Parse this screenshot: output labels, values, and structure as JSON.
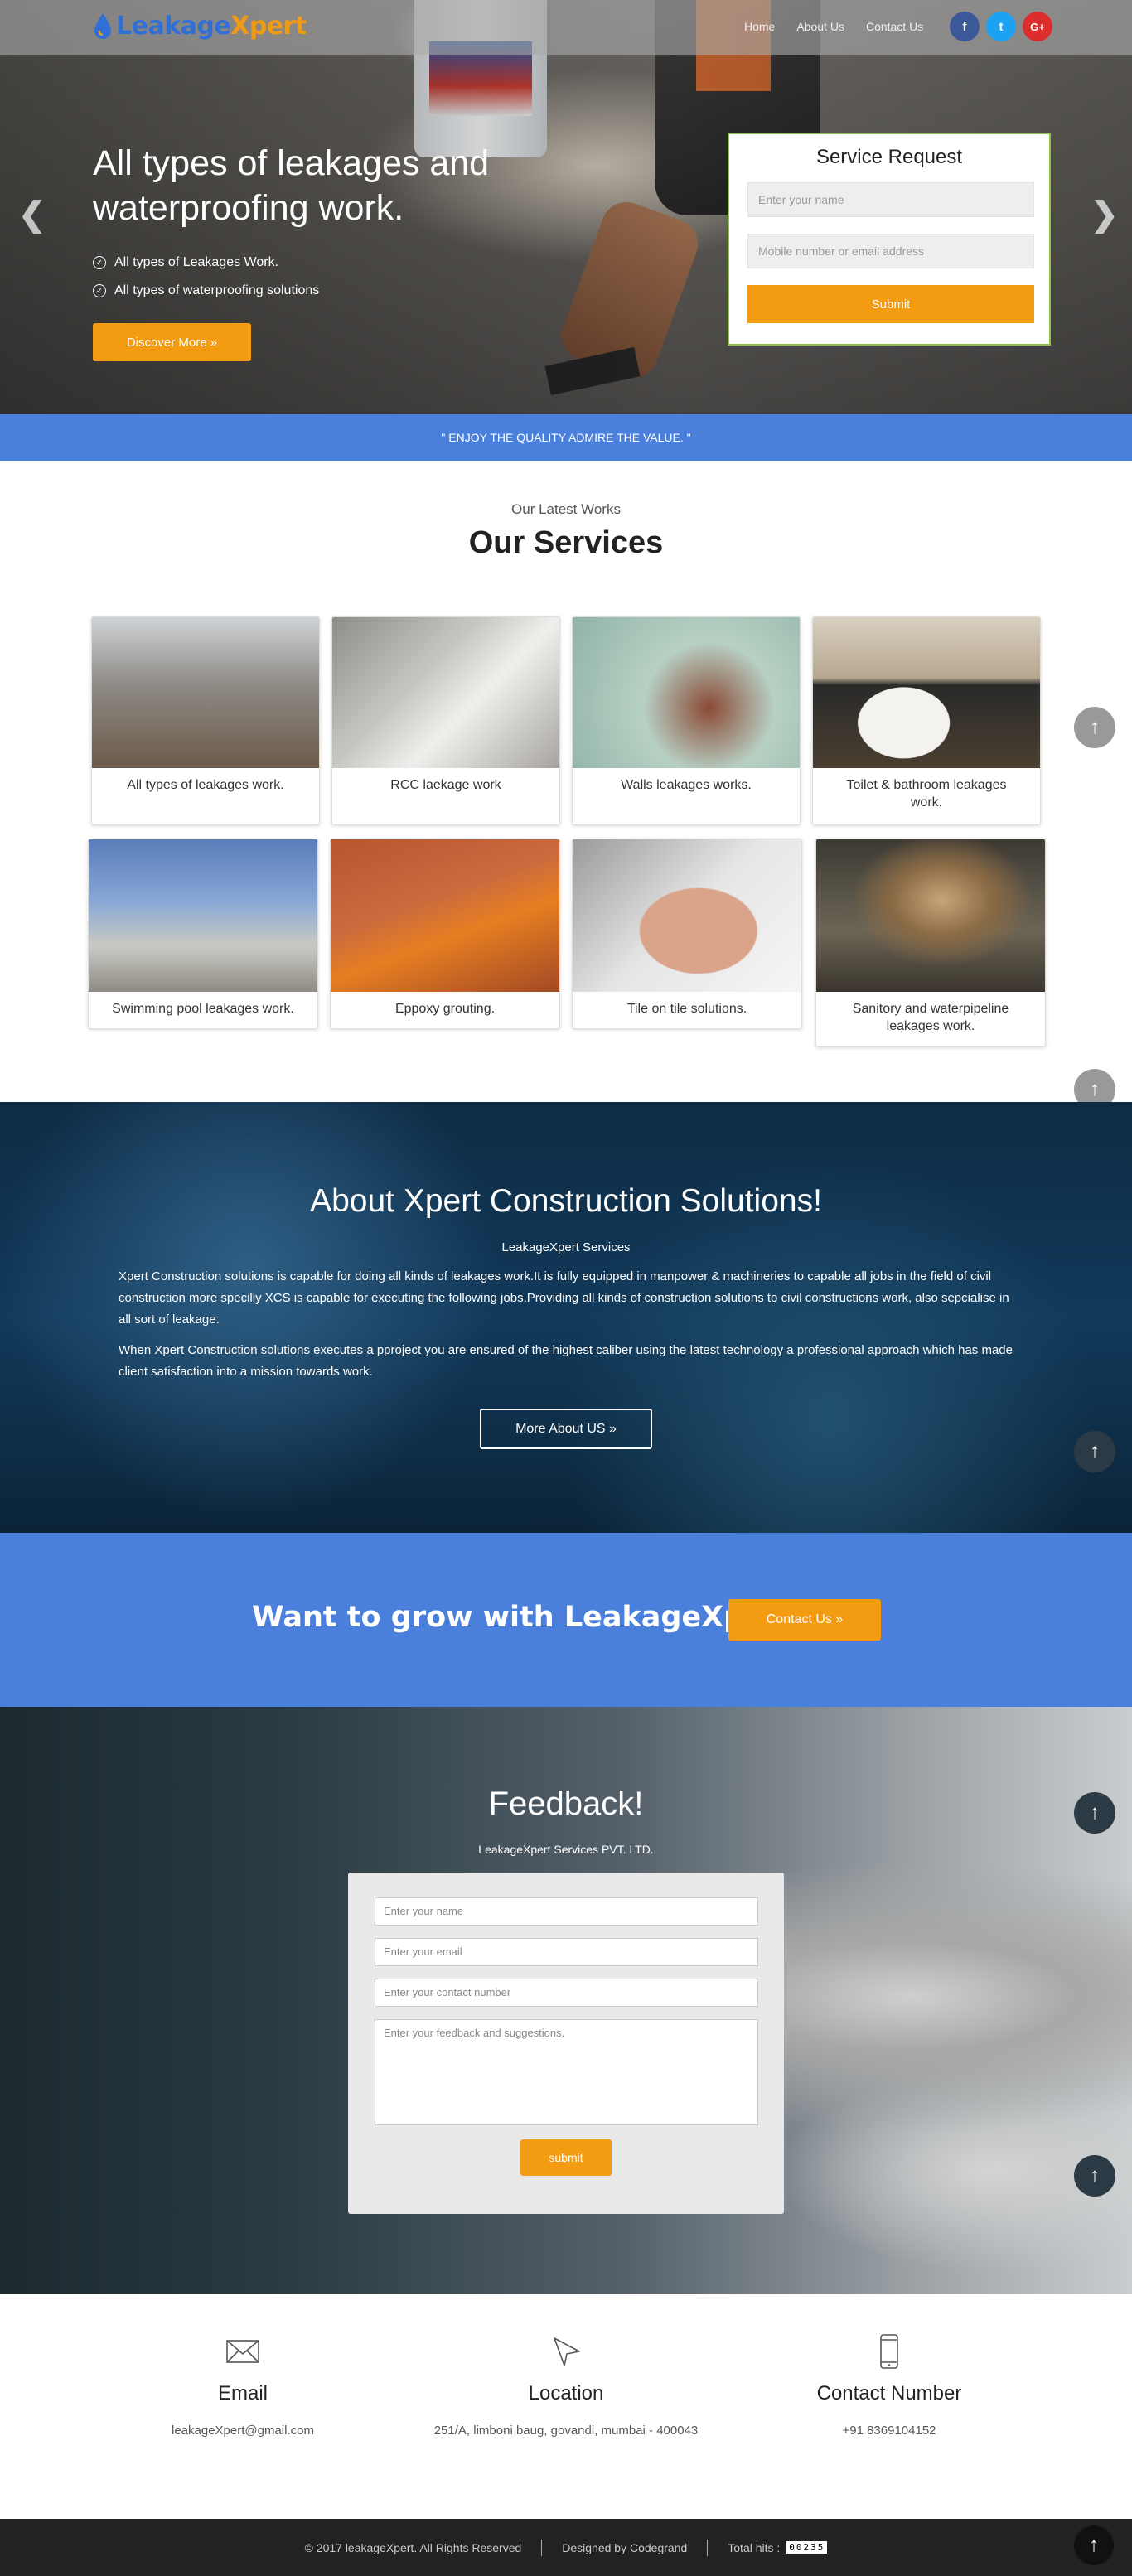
{
  "header": {
    "logo_part1": "Leakage",
    "logo_part2": "Xpert",
    "nav": [
      "Home",
      "About Us",
      "Contact Us"
    ],
    "social": [
      {
        "icon": "facebook-icon",
        "glyph": "f",
        "color": "#3b5998"
      },
      {
        "icon": "twitter-icon",
        "glyph": "t",
        "color": "#1da1f2"
      },
      {
        "icon": "google-plus-icon",
        "glyph": "G+",
        "color": "#dd2c2c"
      }
    ]
  },
  "hero": {
    "title": "All types of leakages and waterproofing work.",
    "bullets": [
      "All types of Leakages Work.",
      "All types of waterproofing solutions"
    ],
    "discover_label": "Discover More »"
  },
  "service_request": {
    "title": "Service Request",
    "name_placeholder": "Enter your name",
    "contact_placeholder": "Mobile number or email address",
    "submit_label": "Submit"
  },
  "tagline": "\" ENJOY THE QUALITY ADMIRE THE VALUE. \"",
  "services": {
    "subtitle": "Our Latest Works",
    "title": "Our Services",
    "items": [
      "All types of leakages work.",
      "RCC laekage work",
      "Walls leakages works.",
      "Toilet & bathroom leakages work.",
      "Swimming pool leakages work.",
      "Eppoxy grouting.",
      "Tile on tile solutions.",
      "Sanitory and waterpipeline leakages work."
    ]
  },
  "about": {
    "title": "About Xpert Construction Solutions!",
    "subtitle": "LeakageXpert Services",
    "p1": "Xpert Construction solutions is capable for doing all kinds of leakages work.It is fully equipped in manpower & machineries to capable all jobs in the field of civil construction more specilly XCS is capable for executing the following jobs.Providing all kinds of construction solutions to civil constructions work, also sepcialise in all sort of leakage.",
    "p2": "When Xpert Construction solutions executes a pproject you are ensured of the highest caliber using the latest technology a professional approach which has made client satisfaction into a mission towards work.",
    "more_label": "More About US »"
  },
  "grow": {
    "title": "Want to grow with LeakageXpert",
    "contact_label": "Contact Us »"
  },
  "feedback": {
    "title": "Feedback!",
    "subtitle": "LeakageXpert Services PVT. LTD.",
    "name_placeholder": "Enter your name",
    "email_placeholder": "Enter your email",
    "phone_placeholder": "Enter your contact number",
    "message_placeholder": "Enter your feedback and suggestions.",
    "submit_label": "submit"
  },
  "contact": {
    "email_title": "Email",
    "email_value": "leakageXpert@gmail.com",
    "location_title": "Location",
    "location_value": "251/A, limboni baug, govandi, mumbai - 400043",
    "phone_title": "Contact Number",
    "phone_value": "+91 8369104152"
  },
  "footer": {
    "copyright": "© 2017 leakageXpert. All Rights Reserved",
    "designed": "Designed by Codegrand",
    "hits_label": "Total hits :",
    "hits_value": "00235"
  },
  "colors": {
    "accent_orange": "#f39c12",
    "accent_blue": "#4a80dc",
    "footer_bg": "#222222"
  }
}
